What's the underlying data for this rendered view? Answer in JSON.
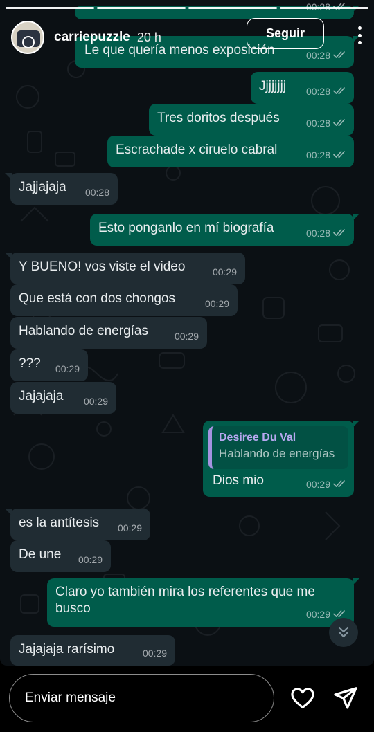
{
  "story": {
    "username": "carriepuzzle",
    "time_ago": "20 h",
    "follow_label": "Seguir",
    "progress_segments": 4
  },
  "messages": [
    {
      "dir": "out",
      "text": "",
      "time": "00:28",
      "cut": true
    },
    {
      "dir": "out",
      "text": "Le que quería menos exposición",
      "time": "00:28"
    },
    {
      "dir": "out",
      "text": "Jjjjjjjj",
      "time": "00:28"
    },
    {
      "dir": "out",
      "text": "Tres doritos después",
      "time": "00:28"
    },
    {
      "dir": "out",
      "text": "Escrachade x ciruelo cabral",
      "time": "00:28"
    },
    {
      "dir": "in",
      "text": "Jajjajaja",
      "time": "00:28"
    },
    {
      "dir": "out",
      "text": "Esto ponganlo en mí biografía",
      "time": "00:28"
    },
    {
      "dir": "in",
      "text": "Y BUENO! vos viste el video",
      "time": "00:29"
    },
    {
      "dir": "in",
      "text": "Que está con dos chongos",
      "time": "00:29"
    },
    {
      "dir": "in",
      "text": "Hablando de energías",
      "time": "00:29"
    },
    {
      "dir": "in",
      "text": "???",
      "time": "00:29"
    },
    {
      "dir": "in",
      "text": "Jajajaja",
      "time": "00:29"
    },
    {
      "dir": "out",
      "text": "Dios mio",
      "time": "00:29",
      "quote": {
        "name": "Desiree Du Val",
        "text": "Hablando de energías"
      }
    },
    {
      "dir": "in",
      "text": "es la antítesis",
      "time": "00:29"
    },
    {
      "dir": "in",
      "text": "De une",
      "time": "00:29"
    },
    {
      "dir": "out",
      "text": "Claro yo también mira los referentes que me busco",
      "time": "00:29"
    },
    {
      "dir": "in",
      "text": "Jajajaja rarísimo",
      "time": "00:29"
    }
  ],
  "reply": {
    "placeholder": "Enviar mensaje"
  },
  "icons": {
    "more": "more-vertical-icon",
    "scroll": "double-chevron-down-icon",
    "like": "heart-icon",
    "send": "paper-plane-icon",
    "read": "double-check-icon"
  },
  "colors": {
    "outgoing_bubble": "#005c4b",
    "incoming_bubble": "#202c33",
    "chat_background": "#0b1014",
    "quote_bar": "#a593e0"
  }
}
